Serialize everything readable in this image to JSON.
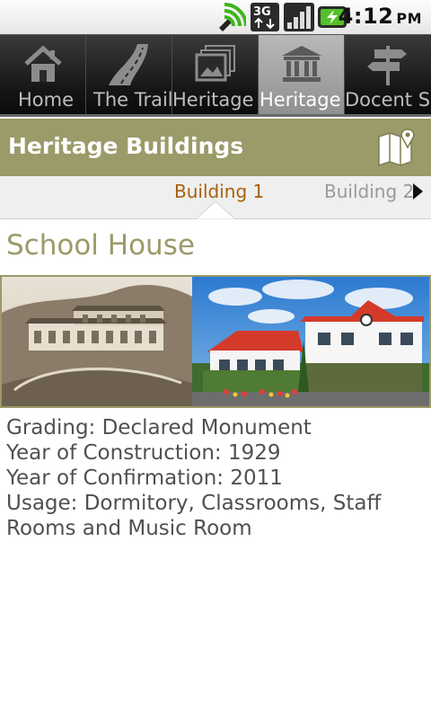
{
  "status_bar": {
    "time": "4:12",
    "ampm": "PM",
    "network": "3G",
    "icons": [
      "sync-icon",
      "3g-network-icon",
      "signal-strength-icon",
      "battery-charging-icon"
    ]
  },
  "tabs": [
    {
      "label": "Home",
      "icon": "home-icon",
      "active": false
    },
    {
      "label": "The Trail",
      "icon": "road-icon",
      "active": false
    },
    {
      "label": "Heritage Gallery",
      "icon": "gallery-icon",
      "active": false
    },
    {
      "label": "Heritage Buildings",
      "icon": "museum-icon",
      "active": true
    },
    {
      "label": "Docent Service",
      "icon": "signpost-icon",
      "active": false
    }
  ],
  "header": {
    "title": "Heritage Buildings",
    "map_icon": "map-icon"
  },
  "pager": {
    "current": "Building 1",
    "next": "Building 2"
  },
  "building": {
    "name": "School House",
    "details": [
      "Grading: Declared Monument",
      "Year of Construction: 1929",
      "Year of Confirmation: 2011",
      "Usage: Dormitory, Classrooms, Staff Rooms and Music Room"
    ]
  },
  "colors": {
    "accent": "#9b9a69",
    "active_page": "#a8600c",
    "body_text": "#505050"
  }
}
